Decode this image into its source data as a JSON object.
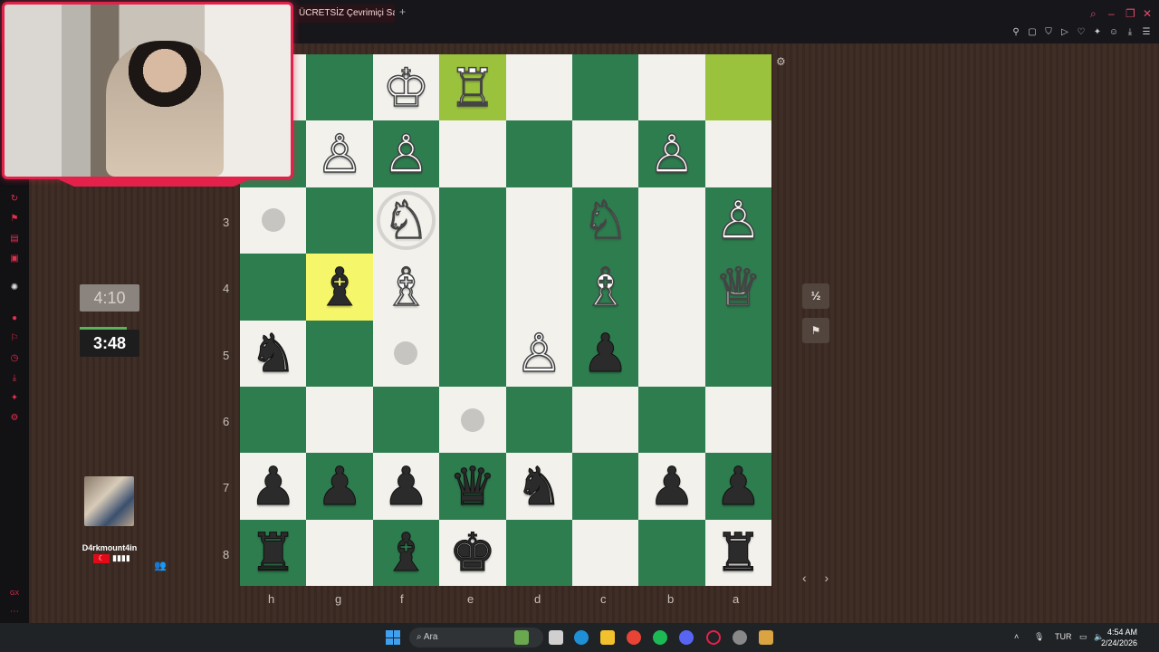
{
  "browser": {
    "tab_title": "ÜCRETSİZ Çevrimiçi Satranç",
    "new_tab": "+"
  },
  "board": {
    "ranks": [
      "",
      "",
      "3",
      "4",
      "5",
      "6",
      "7",
      "8"
    ],
    "files": [
      "h",
      "g",
      "f",
      "e",
      "d",
      "c",
      "b",
      "a"
    ],
    "squares": [
      [
        {
          "c": "light",
          "p": ""
        },
        {
          "c": "dark",
          "p": ""
        },
        {
          "c": "light",
          "p": "♔",
          "s": "w"
        },
        {
          "c": "hl-move",
          "p": "♖",
          "s": "w"
        },
        {
          "c": "light",
          "p": ""
        },
        {
          "c": "dark",
          "p": ""
        },
        {
          "c": "light",
          "p": ""
        },
        {
          "c": "hl-move",
          "p": ""
        }
      ],
      [
        {
          "c": "dark",
          "p": ""
        },
        {
          "c": "light",
          "p": "♙",
          "s": "w"
        },
        {
          "c": "dark",
          "p": "♙",
          "s": "w"
        },
        {
          "c": "light",
          "p": ""
        },
        {
          "c": "dark",
          "p": ""
        },
        {
          "c": "light",
          "p": ""
        },
        {
          "c": "dark",
          "p": "♙",
          "s": "w"
        },
        {
          "c": "light",
          "p": ""
        }
      ],
      [
        {
          "c": "light",
          "hint": true
        },
        {
          "c": "dark",
          "p": ""
        },
        {
          "c": "light",
          "p": "♘",
          "s": "w",
          "ring": true
        },
        {
          "c": "dark",
          "p": ""
        },
        {
          "c": "light",
          "p": ""
        },
        {
          "c": "dark",
          "p": "♘",
          "s": "w"
        },
        {
          "c": "light",
          "p": ""
        },
        {
          "c": "dark",
          "p": "♙",
          "s": "w"
        }
      ],
      [
        {
          "c": "dark",
          "p": ""
        },
        {
          "c": "hl-sel",
          "p": "♝",
          "s": "b"
        },
        {
          "c": "light",
          "p": "♗",
          "s": "w"
        },
        {
          "c": "dark",
          "p": ""
        },
        {
          "c": "light",
          "p": ""
        },
        {
          "c": "dark",
          "p": "♗",
          "s": "w"
        },
        {
          "c": "light",
          "p": ""
        },
        {
          "c": "dark",
          "p": "♕",
          "s": "w"
        }
      ],
      [
        {
          "c": "light",
          "p": "♞",
          "s": "b"
        },
        {
          "c": "dark",
          "p": ""
        },
        {
          "c": "light",
          "hint": true
        },
        {
          "c": "dark",
          "p": ""
        },
        {
          "c": "light",
          "p": "♙",
          "s": "w"
        },
        {
          "c": "dark",
          "p": "♟",
          "s": "b"
        },
        {
          "c": "light",
          "p": ""
        },
        {
          "c": "dark",
          "p": ""
        }
      ],
      [
        {
          "c": "dark",
          "p": ""
        },
        {
          "c": "light",
          "p": ""
        },
        {
          "c": "dark",
          "p": ""
        },
        {
          "c": "light",
          "hint": true
        },
        {
          "c": "dark",
          "p": ""
        },
        {
          "c": "light",
          "p": ""
        },
        {
          "c": "dark",
          "p": ""
        },
        {
          "c": "light",
          "p": ""
        }
      ],
      [
        {
          "c": "light",
          "p": "♟",
          "s": "b"
        },
        {
          "c": "dark",
          "p": "♟",
          "s": "b"
        },
        {
          "c": "light",
          "p": "♟",
          "s": "b"
        },
        {
          "c": "dark",
          "p": "♛",
          "s": "b"
        },
        {
          "c": "light",
          "p": "♞",
          "s": "b"
        },
        {
          "c": "dark",
          "p": ""
        },
        {
          "c": "light",
          "p": "♟",
          "s": "b"
        },
        {
          "c": "dark",
          "p": "♟",
          "s": "b"
        }
      ],
      [
        {
          "c": "dark",
          "p": "♜",
          "s": "b"
        },
        {
          "c": "light",
          "p": ""
        },
        {
          "c": "dark",
          "p": "♝",
          "s": "b"
        },
        {
          "c": "light",
          "p": "♚",
          "s": "b"
        },
        {
          "c": "dark",
          "p": ""
        },
        {
          "c": "light",
          "p": ""
        },
        {
          "c": "dark",
          "p": ""
        },
        {
          "c": "light",
          "p": "♜",
          "s": "b"
        }
      ]
    ]
  },
  "clocks": {
    "opponent": "4:10",
    "player": "3:48"
  },
  "opponent": {
    "name": "D4rkmount4in",
    "signal": "▮▮▮▮"
  },
  "controls": {
    "draw": "½",
    "resign": "⚑",
    "settings": "⚙",
    "nav": "‹ ›"
  },
  "taskbar": {
    "search_placeholder": "Ara",
    "lang": "TUR",
    "time": "4:54 AM",
    "date": "2/24/2026"
  },
  "colors": {
    "light_square": "#f2f1ec",
    "dark_square": "#2e7d4f",
    "last_move": "#9bc23d",
    "selected": "#f6f66a",
    "accent": "#e3214a"
  }
}
